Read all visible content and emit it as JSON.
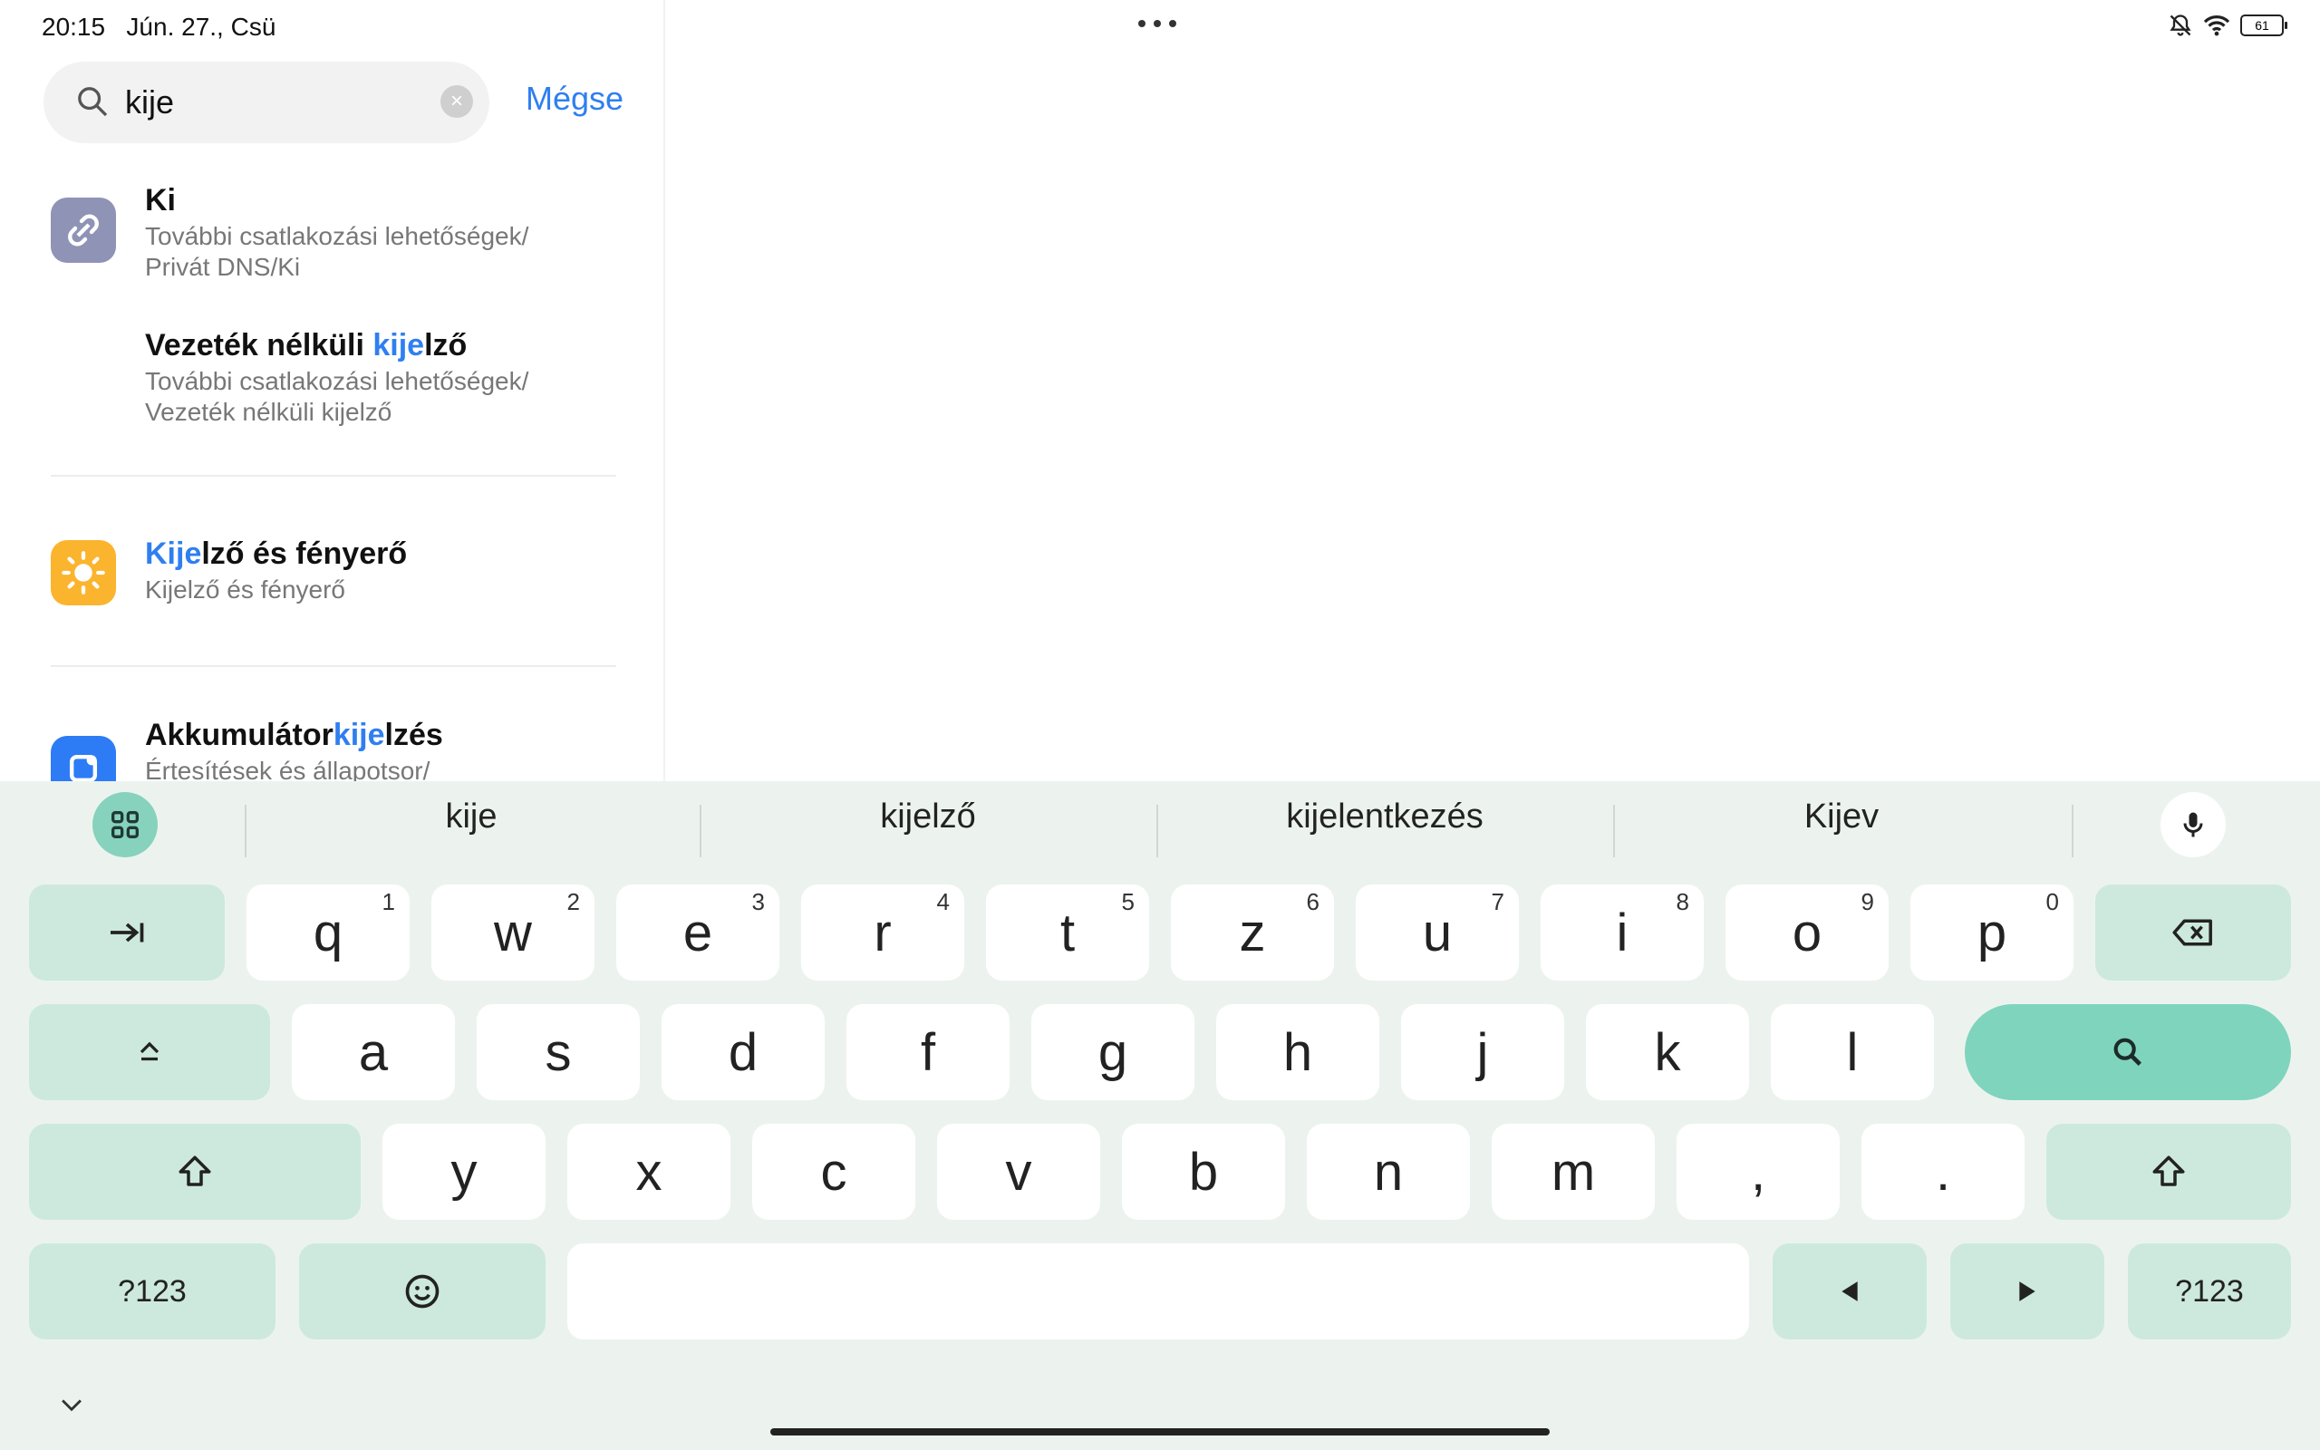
{
  "status": {
    "time": "20:15",
    "date": "Jún. 27., Csü",
    "battery": "61"
  },
  "search": {
    "query": "kije",
    "cancel": "Mégse"
  },
  "results": [
    {
      "icon": "link-icon",
      "icon_color": "#8f93b6",
      "title_pre": "Ki",
      "title_hl": "",
      "title_post": "",
      "sub1": "További csatlakozási lehetőségek/",
      "sub2": "Privát DNS/Ki"
    },
    {
      "icon": "",
      "title_pre": "Vezeték nélküli ",
      "title_hl": "kije",
      "title_post": "lző",
      "sub1": "További csatlakozási lehetőségek/",
      "sub2": "Vezeték nélküli kijelző"
    },
    {
      "icon": "sun-icon",
      "icon_color": "#fbb42d",
      "title_pre": "",
      "title_hl": "Kije",
      "title_post": "lző és fényerő",
      "sub1": "Kijelző és fényerő",
      "sub2": ""
    },
    {
      "icon": "notification-icon",
      "icon_color": "#2d7cf6",
      "title_pre": "Akkumulátor",
      "title_hl": "kije",
      "title_post": "lzés",
      "sub1": "Értesítések és állapotsor/",
      "sub2": ""
    }
  ],
  "suggestions": [
    "kije",
    "kijelző",
    "kijelentkezés",
    "Kijev"
  ],
  "keys": {
    "row1": [
      {
        "l": "q",
        "n": "1"
      },
      {
        "l": "w",
        "n": "2"
      },
      {
        "l": "e",
        "n": "3"
      },
      {
        "l": "r",
        "n": "4"
      },
      {
        "l": "t",
        "n": "5"
      },
      {
        "l": "z",
        "n": "6"
      },
      {
        "l": "u",
        "n": "7"
      },
      {
        "l": "i",
        "n": "8"
      },
      {
        "l": "o",
        "n": "9"
      },
      {
        "l": "p",
        "n": "0"
      }
    ],
    "row2": [
      "a",
      "s",
      "d",
      "f",
      "g",
      "h",
      "j",
      "k",
      "l"
    ],
    "row3": [
      "y",
      "x",
      "c",
      "v",
      "b",
      "n",
      "m",
      ",",
      "."
    ],
    "sym_left": "?123",
    "sym_right": "?123"
  },
  "colors": {
    "accent": "#2f7ff0",
    "keyboard_bg": "#ecf3ef",
    "func_key": "#cde9de",
    "action_key": "#7fd4bd"
  }
}
